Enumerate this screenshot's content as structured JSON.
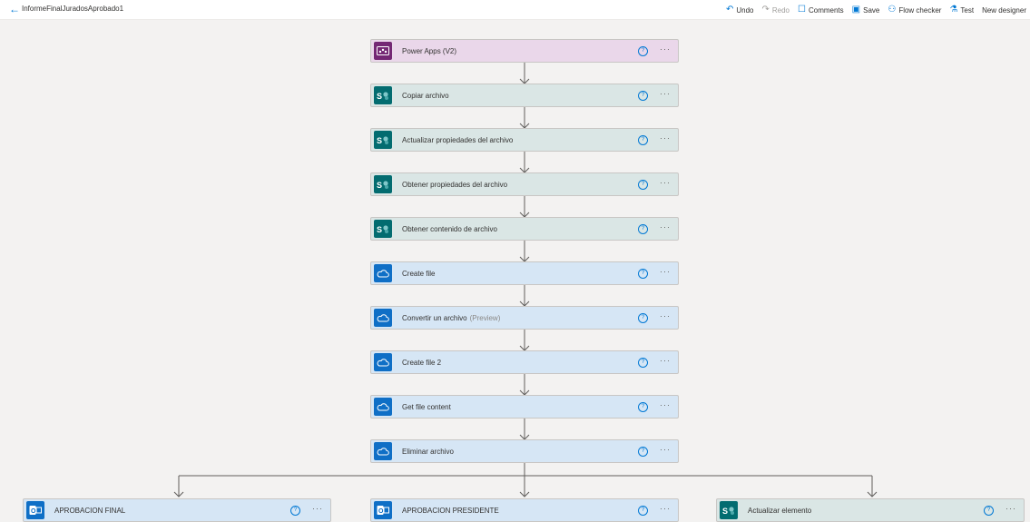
{
  "header": {
    "back_icon": "back-arrow-icon",
    "flow_title": "InformeFinalJuradosAprobado1"
  },
  "toolbar": {
    "undo": "Undo",
    "redo": "Redo",
    "comments": "Comments",
    "save": "Save",
    "flow_checker": "Flow checker",
    "test": "Test",
    "new_designer": "New designer"
  },
  "steps": [
    {
      "label": "Power Apps (V2)",
      "connector": "power-apps"
    },
    {
      "label": "Copiar archivo",
      "connector": "sharepoint"
    },
    {
      "label": "Actualizar propiedades del archivo",
      "connector": "sharepoint"
    },
    {
      "label": "Obtener propiedades del archivo",
      "connector": "sharepoint"
    },
    {
      "label": "Obtener contenido de archivo",
      "connector": "sharepoint"
    },
    {
      "label": "Create file",
      "connector": "onedrive"
    },
    {
      "label": "Convertir un archivo",
      "suffix": "(Preview)",
      "connector": "onedrive"
    },
    {
      "label": "Create file 2",
      "connector": "onedrive"
    },
    {
      "label": "Get file content",
      "connector": "onedrive"
    },
    {
      "label": "Eliminar archivo",
      "connector": "onedrive"
    }
  ],
  "branches": [
    {
      "label": "APROBACION FINAL",
      "connector": "outlook"
    },
    {
      "label": "APROBACION PRESIDENTE",
      "connector": "outlook"
    },
    {
      "label": "Actualizar elemento",
      "connector": "sharepoint"
    }
  ],
  "card_actions": {
    "help": "?",
    "more": "···"
  },
  "colors": {
    "accent": "#0078d4",
    "power_apps": "#742774",
    "sharepoint": "#036c70",
    "onedrive": "#0f6fc6",
    "outlook": "#0f6fc6"
  }
}
